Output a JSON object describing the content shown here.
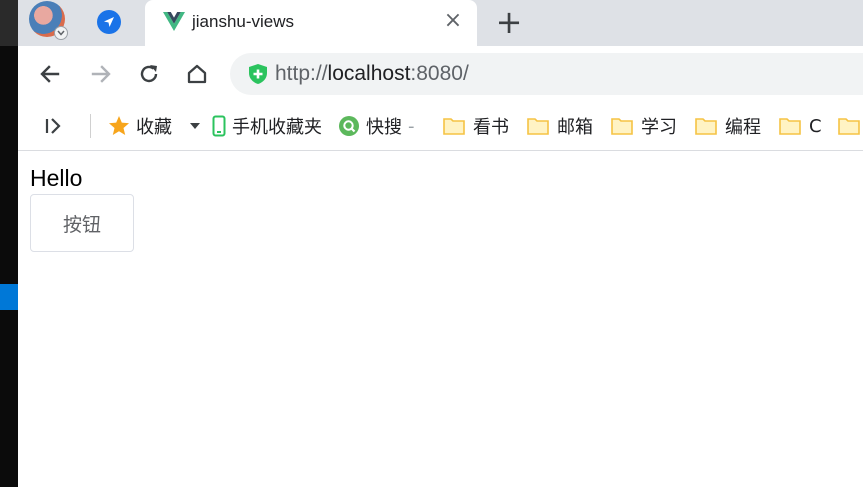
{
  "tab": {
    "title": "jianshu-views",
    "close_glyph": "×",
    "favicon": "vue-logo-icon"
  },
  "new_tab_glyph": "+",
  "toolbar": {
    "back_icon": "back-arrow-icon",
    "forward_icon": "forward-arrow-icon",
    "reload_icon": "reload-icon",
    "home_icon": "home-icon",
    "url_scheme": "http://",
    "url_host": "localhost",
    "url_rest": ":8080/"
  },
  "bookmarks": {
    "favorites_label": "收藏",
    "mobile_label": "手机收藏夹",
    "search_label": "快搜",
    "search_suffix": "-",
    "folders": [
      "看书",
      "邮箱",
      "学习",
      "编程",
      "C"
    ]
  },
  "page": {
    "heading": "Hello",
    "button_label": "按钮"
  },
  "colors": {
    "tabstrip": "#dee1e6",
    "vue_green": "#41b883",
    "vue_dark": "#35495e",
    "shield_green": "#2bc35e",
    "star": "#f7a51c",
    "folder": "#f5c344"
  }
}
